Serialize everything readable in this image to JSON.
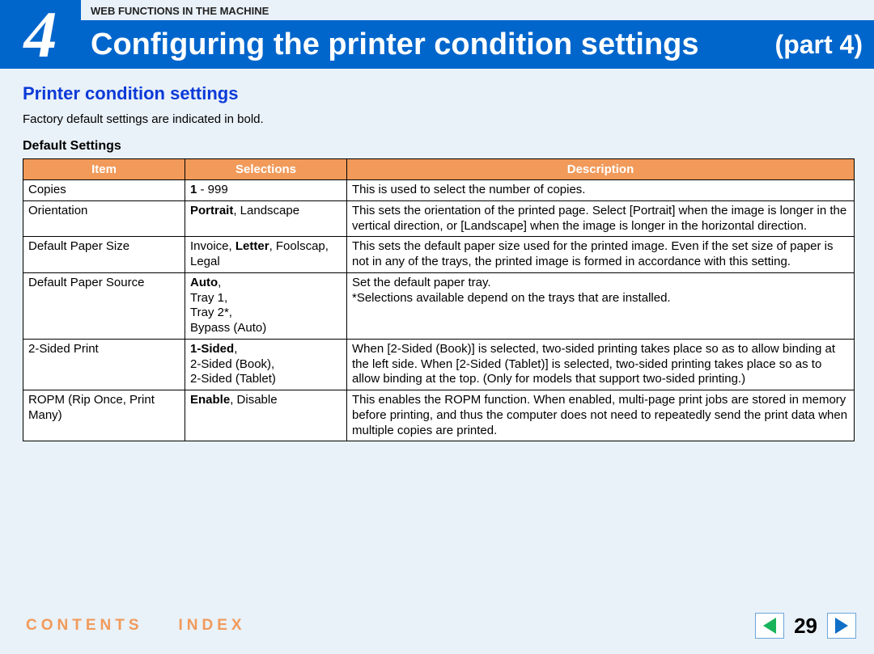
{
  "header": {
    "chapter_number": "4",
    "breadcrumb": "WEB FUNCTIONS IN THE MACHINE",
    "title": "Configuring the printer condition settings",
    "part": "(part 4)"
  },
  "section": {
    "title": "Printer condition settings",
    "intro": "Factory default settings are indicated in bold.",
    "subheading": "Default Settings"
  },
  "table": {
    "headers": {
      "item": "Item",
      "selections": "Selections",
      "description": "Description"
    },
    "rows": [
      {
        "item": "Copies",
        "sel_bold1": "1",
        "sel_mid1": " - 999",
        "desc": "This is used to select the number of copies."
      },
      {
        "item": "Orientation",
        "sel_bold1": "Portrait",
        "sel_mid1": ", Landscape",
        "desc": "This sets the orientation of the printed page. Select [Portrait] when the image is longer in the vertical direction, or [Landscape] when the image is longer in the horizontal direction."
      },
      {
        "item": "Default Paper Size",
        "sel_pre": "Invoice, ",
        "sel_bold1": "Letter",
        "sel_mid1": ", Foolscap, Legal",
        "desc": "This sets the default paper size used for the printed image. Even if the set size of paper is not in any of the trays, the printed image is formed in accordance with this setting."
      },
      {
        "item": "Default Paper Source",
        "sel_bold1": "Auto",
        "sel_mid1": ",",
        "sel_line2": "Tray 1,",
        "sel_line3": "Tray 2*,",
        "sel_line4": "Bypass (Auto)",
        "desc": "Set the default paper tray.",
        "desc2": "*Selections available depend on the trays that are installed."
      },
      {
        "item": "2-Sided Print",
        "sel_bold1": "1-Sided",
        "sel_mid1": ",",
        "sel_line2": "2-Sided (Book),",
        "sel_line3": "2-Sided (Tablet)",
        "desc": "When [2-Sided (Book)] is selected, two-sided printing takes place so as to allow binding at the left side. When [2-Sided (Tablet)] is selected, two-sided printing takes place so as to allow binding at the top.  (Only for models that support two-sided printing.)"
      },
      {
        "item": "ROPM (Rip Once, Print Many)",
        "sel_bold1": "Enable",
        "sel_mid1": ", Disable",
        "desc": "This enables the ROPM function. When enabled, multi-page print jobs are stored in memory before printing, and thus the computer does not need to repeatedly send the print data when multiple copies are printed."
      }
    ]
  },
  "footer": {
    "contents": "CONTENTS",
    "index": "INDEX",
    "page_number": "29"
  }
}
